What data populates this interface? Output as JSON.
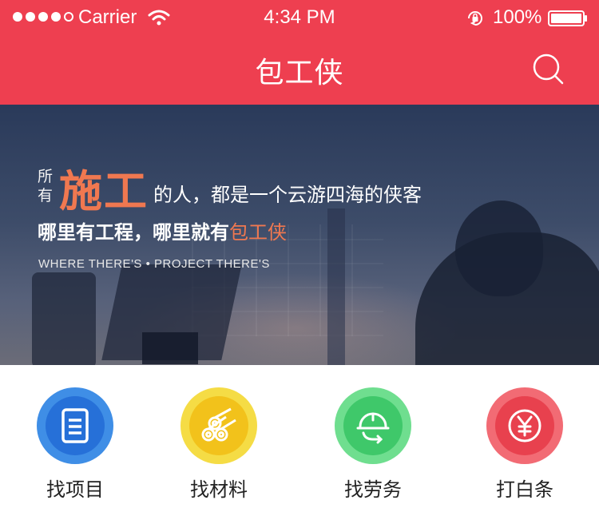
{
  "status_bar": {
    "carrier": "Carrier",
    "time": "4:34 PM",
    "battery": "100%"
  },
  "nav": {
    "title": "包工侠",
    "search_icon": "search-icon"
  },
  "banner": {
    "small_top": "所",
    "small_bottom": "有",
    "big": "施工",
    "rest": "的人，都是一个云游四海的侠客",
    "line2_main": "哪里有工程，哪里就有",
    "line2_accent": "包工侠",
    "slogan": "WHERE THERE'S • PROJECT THERE'S"
  },
  "menu": [
    {
      "label": "找项目",
      "icon": "document-icon",
      "color": "#2670d8"
    },
    {
      "label": "找材料",
      "icon": "pipes-icon",
      "color": "#f2c21b"
    },
    {
      "label": "找劳务",
      "icon": "helmet-icon",
      "color": "#3fc86a"
    },
    {
      "label": "打白条",
      "icon": "yuan-icon",
      "color": "#e8414e"
    }
  ],
  "colors": {
    "header": "#ee3f50",
    "accent": "#f07850"
  }
}
